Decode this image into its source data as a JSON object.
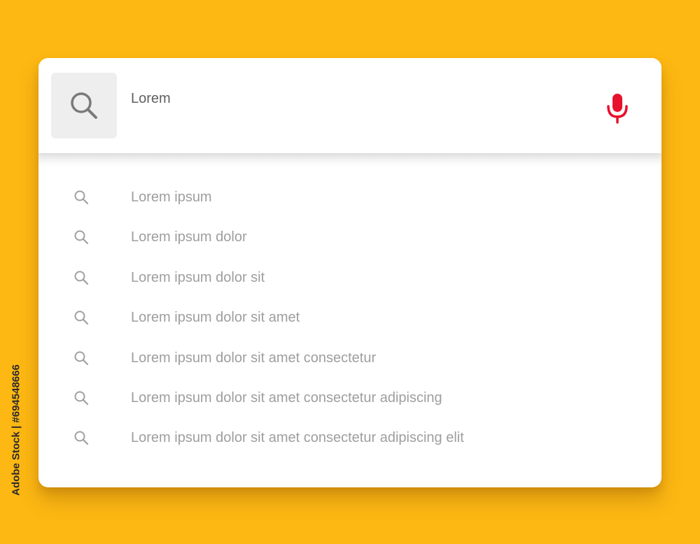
{
  "colors": {
    "background": "#FDB813",
    "card": "#FFFFFF",
    "mic_accent": "#E8112D",
    "suggestion_text": "#9E9E9E",
    "query_text": "#5F5F5F"
  },
  "search": {
    "icon": "search-icon",
    "value": "Lorem",
    "voice_icon": "microphone-icon"
  },
  "suggestions": [
    {
      "icon": "search-icon",
      "label": "Lorem ipsum"
    },
    {
      "icon": "search-icon",
      "label": "Lorem ipsum dolor"
    },
    {
      "icon": "search-icon",
      "label": "Lorem ipsum dolor sit"
    },
    {
      "icon": "search-icon",
      "label": "Lorem ipsum dolor sit amet"
    },
    {
      "icon": "search-icon",
      "label": "Lorem ipsum dolor sit amet consectetur"
    },
    {
      "icon": "search-icon",
      "label": "Lorem ipsum dolor sit amet consectetur adipiscing"
    },
    {
      "icon": "search-icon",
      "label": "Lorem ipsum dolor sit amet consectetur adipiscing elit"
    }
  ],
  "watermark": {
    "credit": "Adobe Stock | #694548666"
  }
}
